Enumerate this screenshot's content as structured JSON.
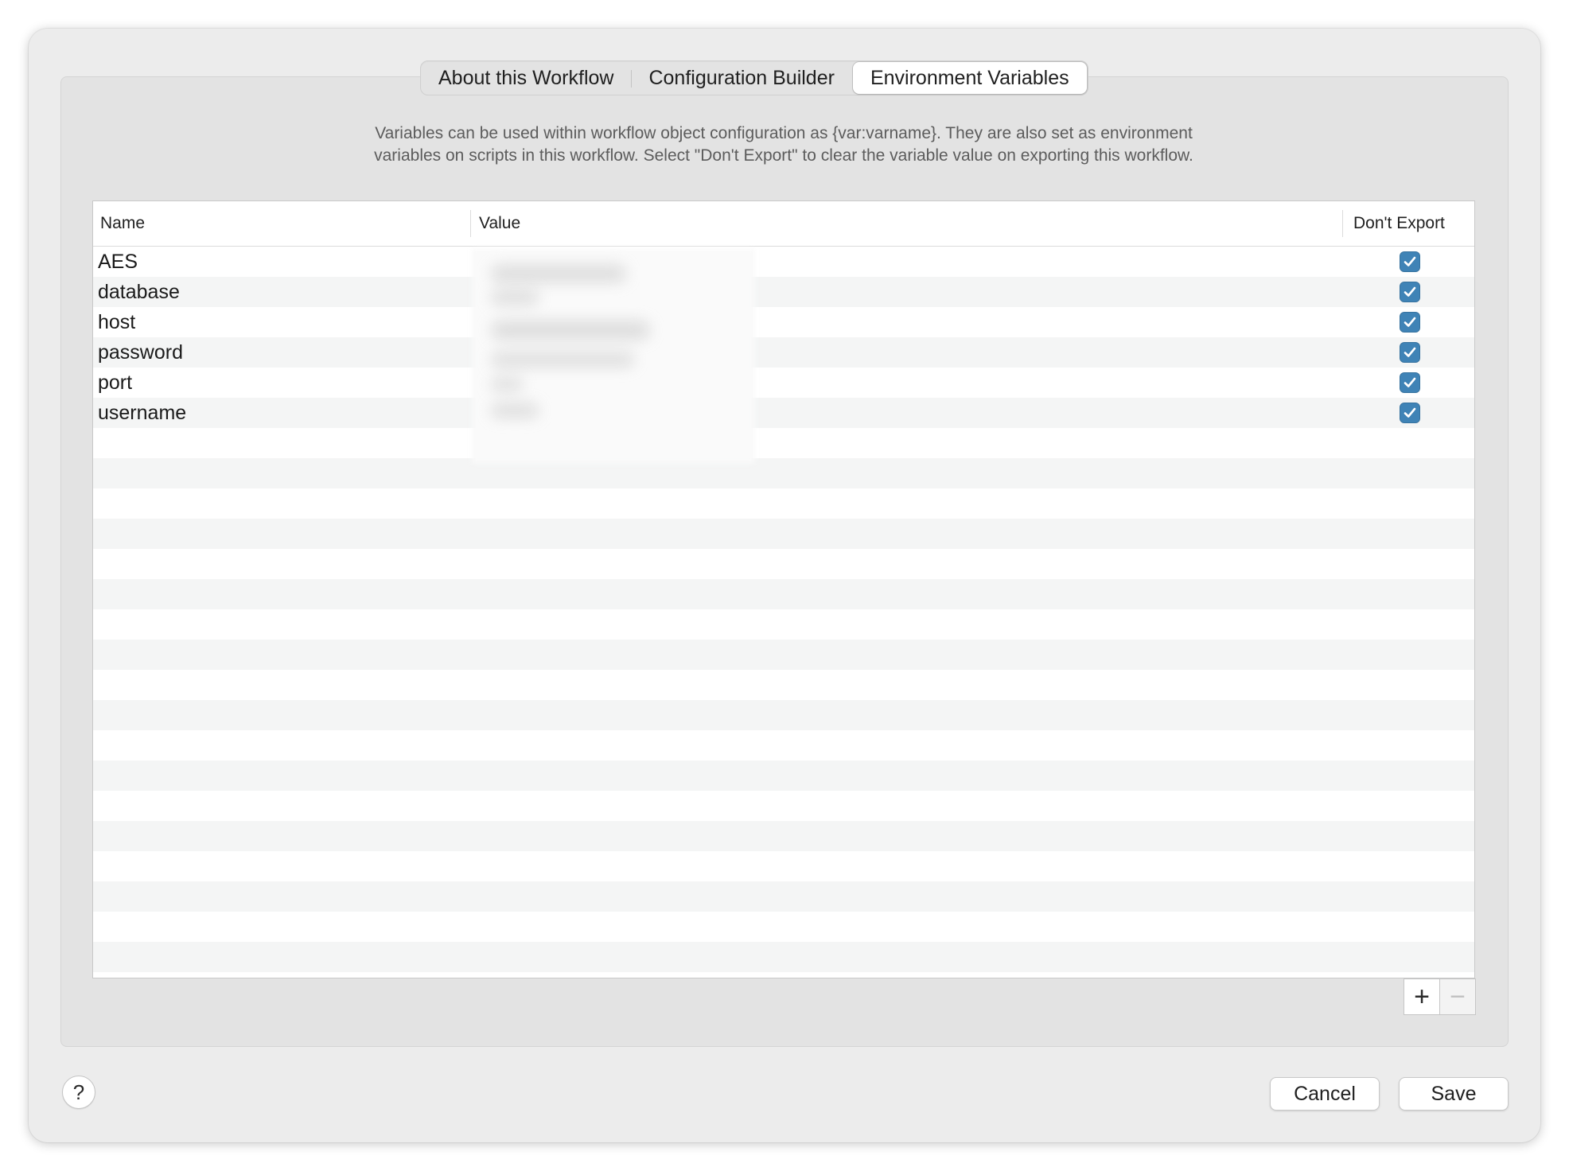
{
  "tabs": [
    {
      "label": "About this Workflow",
      "selected": false
    },
    {
      "label": "Configuration Builder",
      "selected": false
    },
    {
      "label": "Environment Variables",
      "selected": true
    }
  ],
  "description": {
    "line1": "Variables can be used within workflow object configuration as {var:varname}. They are also set as environment",
    "line2": "variables on scripts in this workflow. Select \"Don't Export\" to clear the variable value on exporting this workflow."
  },
  "table": {
    "columns": {
      "name": "Name",
      "value": "Value",
      "dont_export": "Don't Export"
    },
    "rows": [
      {
        "name": "AES",
        "value": "",
        "dont_export": true
      },
      {
        "name": "database",
        "value": "",
        "dont_export": true
      },
      {
        "name": "host",
        "value": "",
        "dont_export": true
      },
      {
        "name": "password",
        "value": "",
        "dont_export": true
      },
      {
        "name": "port",
        "value": "",
        "dont_export": true
      },
      {
        "name": "username",
        "value": "",
        "dont_export": true
      }
    ]
  },
  "controls": {
    "add_label": "+",
    "remove_label": "−",
    "help_label": "?"
  },
  "footer": {
    "cancel_label": "Cancel",
    "save_label": "Save"
  },
  "colors": {
    "checkbox": "#3f83b6",
    "window_bg": "#ececec",
    "alt_row": "#f4f5f5"
  },
  "icons": {
    "checkbox": "checkmark-icon",
    "help": "question-mark-icon"
  }
}
